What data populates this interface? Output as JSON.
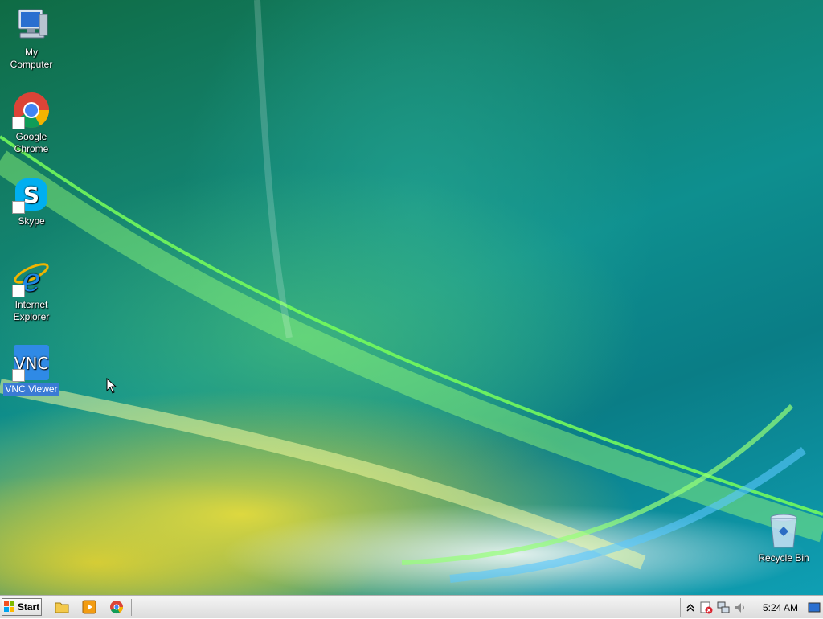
{
  "desktop": {
    "icons": [
      {
        "label": "My Computer",
        "icon": "computer-icon"
      },
      {
        "label": "Google Chrome",
        "label_line1": "Google",
        "label_line2": "Chrome",
        "icon": "chrome-icon"
      },
      {
        "label": "Skype",
        "icon": "skype-icon"
      },
      {
        "label": "Internet Explorer",
        "label_line1": "Internet",
        "label_line2": "Explorer",
        "icon": "ie-icon"
      },
      {
        "label": "VNC Viewer",
        "icon": "vnc-icon",
        "selected": true
      },
      {
        "label": "Recycle Bin",
        "icon": "recycle-bin-icon"
      }
    ]
  },
  "taskbar": {
    "start_label": "Start",
    "quick_launch": [
      "folder-icon",
      "media-player-icon",
      "chrome-icon"
    ],
    "tray": {
      "icons": [
        "show-hidden-icon",
        "security-alert-icon",
        "network-icon",
        "volume-icon",
        "desktop-icon"
      ],
      "clock": "5:24 AM"
    }
  },
  "colors": {
    "selection": "#3a7bd5",
    "taskbar": "#e4e4e4"
  }
}
